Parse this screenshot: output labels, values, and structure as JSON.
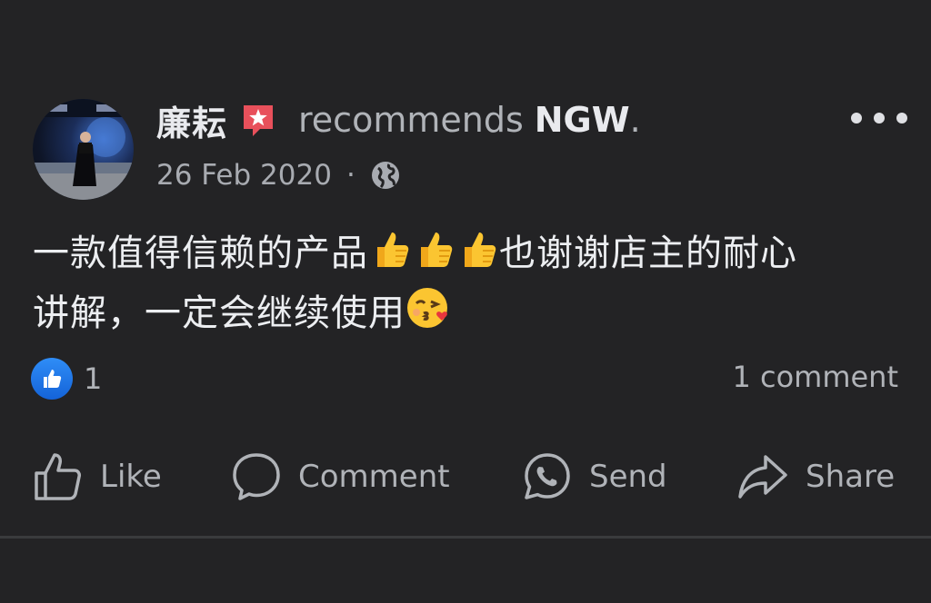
{
  "post": {
    "author": "廉耘",
    "recommends_text": "recommends",
    "page_name": "NGW",
    "period": ".",
    "date": "26 Feb 2020",
    "separator": "·",
    "privacy_icon": "globe-icon",
    "text_line1_a": "一款值得信赖的产品",
    "text_line1_b": "也谢谢店主的耐心",
    "text_line2": "讲解，一定会继续使用",
    "reaction_count": "1",
    "comments_count": "1 comment"
  },
  "actions": {
    "like_label": "Like",
    "comment_label": "Comment",
    "send_label": "Send",
    "share_label": "Share"
  },
  "colors": {
    "background": "#232325",
    "text_primary": "#e9eaee",
    "text_secondary": "#b0b3b8",
    "like_blue": "#1877f2",
    "badge_red": "#e8505b"
  }
}
